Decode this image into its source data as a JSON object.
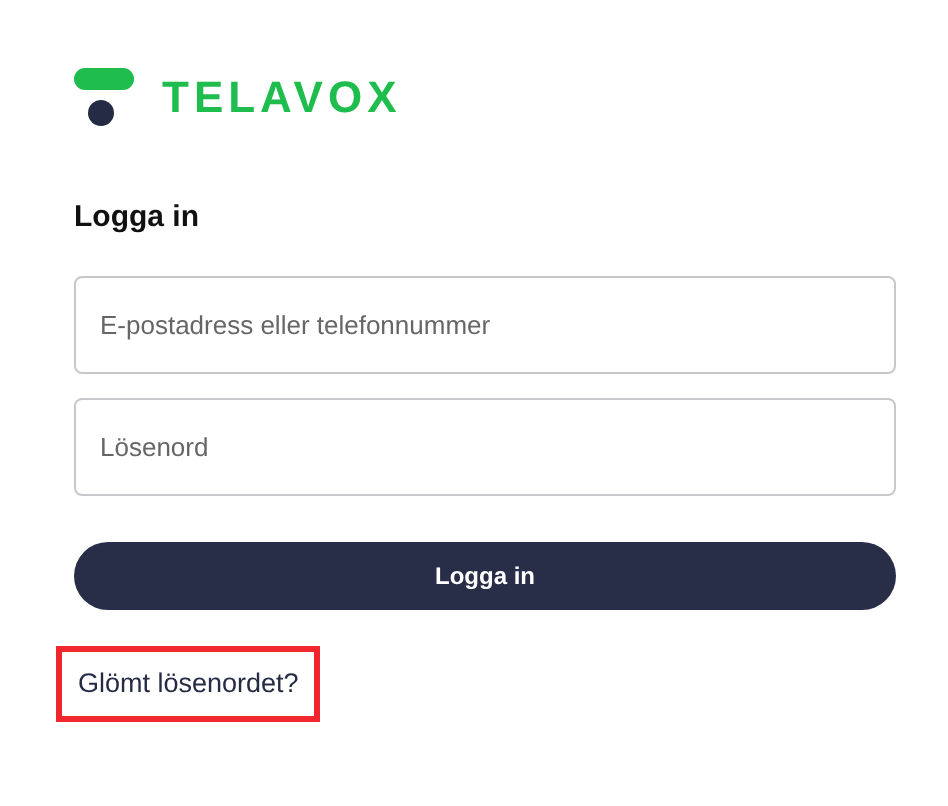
{
  "logo": {
    "text": "TELAVOX"
  },
  "heading": "Logga in",
  "fields": [
    {
      "placeholder": "E-postadress eller telefonnummer"
    },
    {
      "placeholder": "Lösenord"
    }
  ],
  "submit_button": "Logga in",
  "forgot_link": {
    "text": "Glömt lösenordet?",
    "highlighted": true
  }
}
